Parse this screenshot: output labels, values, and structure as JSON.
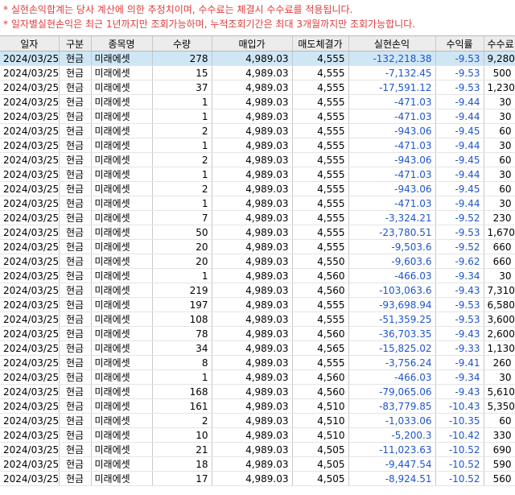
{
  "notices": [
    "* 실현손익합계는 당사 계산에 의한 추정치이며, 수수료는 체결시 수수료를 적용됩니다.",
    "* 일자별실현손익은 최근 1년까지만 조회가능하며, 누적조회기간은 최대 3개월까지만 조회가능합니다."
  ],
  "columns": [
    "일자",
    "구분",
    "종목명",
    "수량",
    "매입가",
    "매도체결가",
    "실현손익",
    "수익률",
    "수수료"
  ],
  "rows": [
    [
      "2024/03/25",
      "현금",
      "미래에셋",
      "278",
      "4,989.03",
      "4,555",
      "-132,218.38",
      "-9.53",
      "9,280"
    ],
    [
      "2024/03/25",
      "현금",
      "미래에셋",
      "15",
      "4,989.03",
      "4,555",
      "-7,132.45",
      "-9.53",
      "500"
    ],
    [
      "2024/03/25",
      "현금",
      "미래에셋",
      "37",
      "4,989.03",
      "4,555",
      "-17,591.12",
      "-9.53",
      "1,230"
    ],
    [
      "2024/03/25",
      "현금",
      "미래에셋",
      "1",
      "4,989.03",
      "4,555",
      "-471.03",
      "-9.44",
      "30"
    ],
    [
      "2024/03/25",
      "현금",
      "미래에셋",
      "1",
      "4,989.03",
      "4,555",
      "-471.03",
      "-9.44",
      "30"
    ],
    [
      "2024/03/25",
      "현금",
      "미래에셋",
      "2",
      "4,989.03",
      "4,555",
      "-943.06",
      "-9.45",
      "60"
    ],
    [
      "2024/03/25",
      "현금",
      "미래에셋",
      "1",
      "4,989.03",
      "4,555",
      "-471.03",
      "-9.44",
      "30"
    ],
    [
      "2024/03/25",
      "현금",
      "미래에셋",
      "2",
      "4,989.03",
      "4,555",
      "-943.06",
      "-9.45",
      "60"
    ],
    [
      "2024/03/25",
      "현금",
      "미래에셋",
      "1",
      "4,989.03",
      "4,555",
      "-471.03",
      "-9.44",
      "30"
    ],
    [
      "2024/03/25",
      "현금",
      "미래에셋",
      "2",
      "4,989.03",
      "4,555",
      "-943.06",
      "-9.45",
      "60"
    ],
    [
      "2024/03/25",
      "현금",
      "미래에셋",
      "1",
      "4,989.03",
      "4,555",
      "-471.03",
      "-9.44",
      "30"
    ],
    [
      "2024/03/25",
      "현금",
      "미래에셋",
      "7",
      "4,989.03",
      "4,555",
      "-3,324.21",
      "-9.52",
      "230"
    ],
    [
      "2024/03/25",
      "현금",
      "미래에셋",
      "50",
      "4,989.03",
      "4,555",
      "-23,780.51",
      "-9.53",
      "1,670"
    ],
    [
      "2024/03/25",
      "현금",
      "미래에셋",
      "20",
      "4,989.03",
      "4,555",
      "-9,503.6",
      "-9.52",
      "660"
    ],
    [
      "2024/03/25",
      "현금",
      "미래에셋",
      "20",
      "4,989.03",
      "4,550",
      "-9,603.6",
      "-9.62",
      "660"
    ],
    [
      "2024/03/25",
      "현금",
      "미래에셋",
      "1",
      "4,989.03",
      "4,560",
      "-466.03",
      "-9.34",
      "30"
    ],
    [
      "2024/03/25",
      "현금",
      "미래에셋",
      "219",
      "4,989.03",
      "4,560",
      "-103,063.6",
      "-9.43",
      "7,310"
    ],
    [
      "2024/03/25",
      "현금",
      "미래에셋",
      "197",
      "4,989.03",
      "4,555",
      "-93,698.94",
      "-9.53",
      "6,580"
    ],
    [
      "2024/03/25",
      "현금",
      "미래에셋",
      "108",
      "4,989.03",
      "4,555",
      "-51,359.25",
      "-9.53",
      "3,600"
    ],
    [
      "2024/03/25",
      "현금",
      "미래에셋",
      "78",
      "4,989.03",
      "4,560",
      "-36,703.35",
      "-9.43",
      "2,600"
    ],
    [
      "2024/03/25",
      "현금",
      "미래에셋",
      "34",
      "4,989.03",
      "4,565",
      "-15,825.02",
      "-9.33",
      "1,130"
    ],
    [
      "2024/03/25",
      "현금",
      "미래에셋",
      "8",
      "4,989.03",
      "4,555",
      "-3,756.24",
      "-9.41",
      "260"
    ],
    [
      "2024/03/25",
      "현금",
      "미래에셋",
      "1",
      "4,989.03",
      "4,560",
      "-466.03",
      "-9.34",
      "30"
    ],
    [
      "2024/03/25",
      "현금",
      "미래에셋",
      "168",
      "4,989.03",
      "4,560",
      "-79,065.06",
      "-9.43",
      "5,610"
    ],
    [
      "2024/03/25",
      "현금",
      "미래에셋",
      "161",
      "4,989.03",
      "4,510",
      "-83,779.85",
      "-10.43",
      "5,350"
    ],
    [
      "2024/03/25",
      "현금",
      "미래에셋",
      "2",
      "4,989.03",
      "4,510",
      "-1,033.06",
      "-10.35",
      "60"
    ],
    [
      "2024/03/25",
      "현금",
      "미래에셋",
      "10",
      "4,989.03",
      "4,510",
      "-5,200.3",
      "-10.42",
      "330"
    ],
    [
      "2024/03/25",
      "현금",
      "미래에셋",
      "21",
      "4,989.03",
      "4,505",
      "-11,023.63",
      "-10.52",
      "690"
    ],
    [
      "2024/03/25",
      "현금",
      "미래에셋",
      "18",
      "4,989.03",
      "4,505",
      "-9,447.54",
      "-10.52",
      "590"
    ],
    [
      "2024/03/25",
      "현금",
      "미래에셋",
      "17",
      "4,989.03",
      "4,505",
      "-8,924.51",
      "-10.52",
      "560"
    ]
  ],
  "selected_row": 0,
  "colors": {
    "notice": "#e03c3c",
    "loss": "#1f55c8",
    "selected": "#cfe6f5"
  }
}
